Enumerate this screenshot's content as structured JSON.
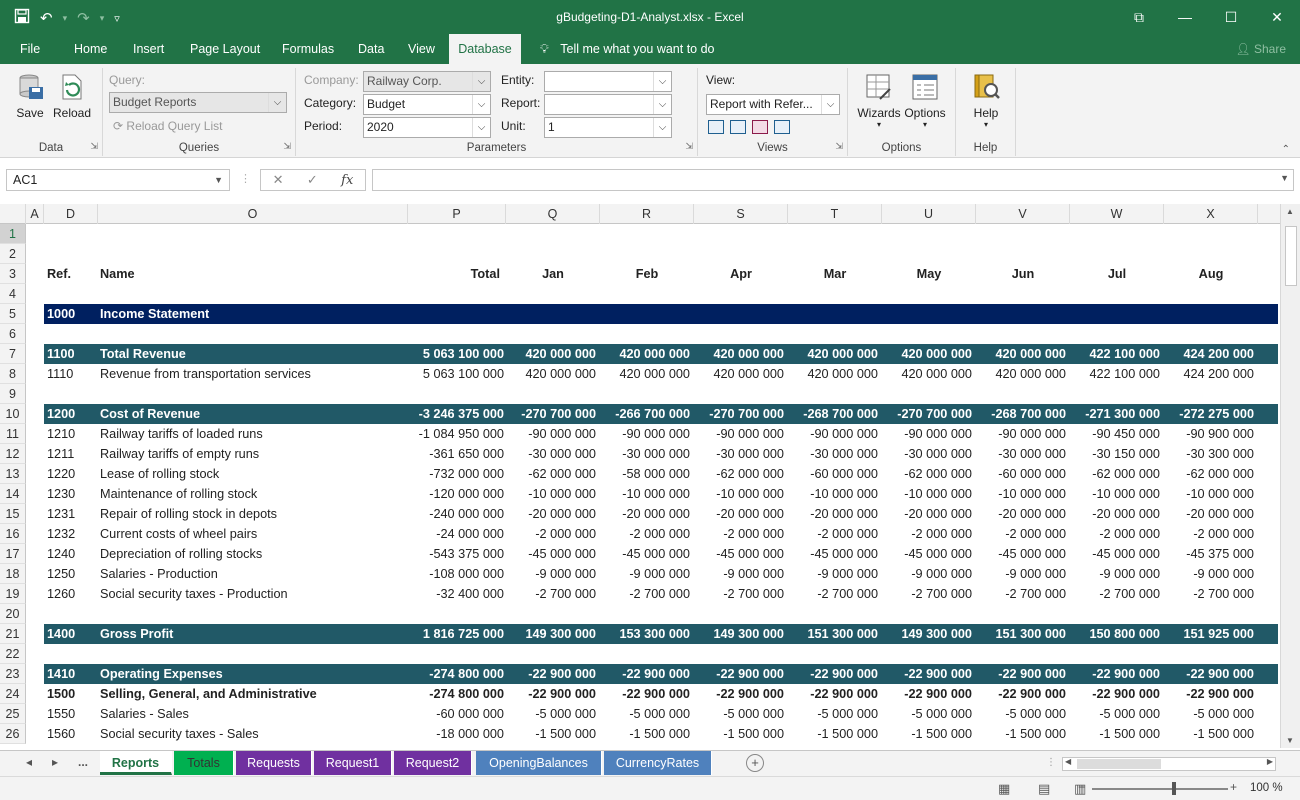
{
  "window": {
    "title": "gBudgeting-D1-Analyst.xlsx  -  Excel"
  },
  "ribbon_tabs": [
    "File",
    "Home",
    "Insert",
    "Page Layout",
    "Formulas",
    "Data",
    "View",
    "Database"
  ],
  "tell_me": "Tell me what you want to do",
  "share_label": "Share",
  "data_group": {
    "label": "Data",
    "save": "Save",
    "reload": "Reload"
  },
  "queries_group": {
    "label": "Queries",
    "query_label": "Query:",
    "query_value": "Budget Reports",
    "reload_list": "Reload Query List"
  },
  "parameters_group": {
    "label": "Parameters",
    "company_label": "Company:",
    "company_value": "Railway Corp.",
    "category_label": "Category:",
    "category_value": "Budget",
    "period_label": "Period:",
    "period_value": "2020",
    "entity_label": "Entity:",
    "entity_value": "",
    "report_label": "Report:",
    "report_value": "",
    "unit_label": "Unit:",
    "unit_value": "1"
  },
  "views_group": {
    "label": "Views",
    "view_label": "View:",
    "view_value": "Report with Refer..."
  },
  "options_group": {
    "label": "Options",
    "wizards": "Wizards",
    "options": "Options"
  },
  "help_group": {
    "label": "Help",
    "help": "Help"
  },
  "formula_bar": {
    "name_box": "AC1",
    "fx": "fx",
    "formula": ""
  },
  "columns": [
    "A",
    "D",
    "O",
    "P",
    "Q",
    "R",
    "S",
    "T",
    "U",
    "V",
    "W",
    "X"
  ],
  "row_numbers": [
    "1",
    "2",
    "3",
    "4",
    "5",
    "6",
    "7",
    "8",
    "9",
    "10",
    "11",
    "12",
    "13",
    "14",
    "15",
    "16",
    "17",
    "18",
    "19",
    "20",
    "21",
    "22",
    "23",
    "24",
    "25",
    "26"
  ],
  "header_row": {
    "ref": "Ref.",
    "name": "Name",
    "months": [
      "Total",
      "Jan",
      "Feb",
      "Apr",
      "Mar",
      "May",
      "Jun",
      "Jul",
      "Aug"
    ]
  },
  "colors": {
    "excel_green": "#217346",
    "income_band": "#002060",
    "total_band": "#215967"
  },
  "rows": [
    {
      "row": 5,
      "style": "band-dark",
      "ref": "1000",
      "name": "Income Statement",
      "values": []
    },
    {
      "row": 7,
      "style": "band",
      "ref": "1100",
      "name": "Total Revenue",
      "values": [
        "5 063 100 000",
        "420 000 000",
        "420 000 000",
        "420 000 000",
        "420 000 000",
        "420 000 000",
        "420 000 000",
        "422 100 000",
        "424 200 000"
      ]
    },
    {
      "row": 8,
      "style": "normal",
      "ref": "1110",
      "name": "Revenue from transportation services",
      "values": [
        "5 063 100 000",
        "420 000 000",
        "420 000 000",
        "420 000 000",
        "420 000 000",
        "420 000 000",
        "420 000 000",
        "422 100 000",
        "424 200 000"
      ]
    },
    {
      "row": 10,
      "style": "band",
      "ref": "1200",
      "name": "Cost of Revenue",
      "values": [
        "-3 246 375 000",
        "-270 700 000",
        "-266 700 000",
        "-270 700 000",
        "-268 700 000",
        "-270 700 000",
        "-268 700 000",
        "-271 300 000",
        "-272 275 000"
      ]
    },
    {
      "row": 11,
      "style": "normal",
      "ref": "1210",
      "name": "Railway tariffs of loaded runs",
      "values": [
        "-1 084 950 000",
        "-90 000 000",
        "-90 000 000",
        "-90 000 000",
        "-90 000 000",
        "-90 000 000",
        "-90 000 000",
        "-90 450 000",
        "-90 900 000"
      ]
    },
    {
      "row": 12,
      "style": "normal",
      "ref": "1211",
      "name": "Railway tariffs of empty runs",
      "values": [
        "-361 650 000",
        "-30 000 000",
        "-30 000 000",
        "-30 000 000",
        "-30 000 000",
        "-30 000 000",
        "-30 000 000",
        "-30 150 000",
        "-30 300 000"
      ]
    },
    {
      "row": 13,
      "style": "normal",
      "ref": "1220",
      "name": "Lease of rolling stock",
      "values": [
        "-732 000 000",
        "-62 000 000",
        "-58 000 000",
        "-62 000 000",
        "-60 000 000",
        "-62 000 000",
        "-60 000 000",
        "-62 000 000",
        "-62 000 000"
      ]
    },
    {
      "row": 14,
      "style": "normal",
      "ref": "1230",
      "name": "Maintenance of rolling stock",
      "values": [
        "-120 000 000",
        "-10 000 000",
        "-10 000 000",
        "-10 000 000",
        "-10 000 000",
        "-10 000 000",
        "-10 000 000",
        "-10 000 000",
        "-10 000 000"
      ]
    },
    {
      "row": 15,
      "style": "normal",
      "ref": "1231",
      "name": "Repair of rolling stock in depots",
      "values": [
        "-240 000 000",
        "-20 000 000",
        "-20 000 000",
        "-20 000 000",
        "-20 000 000",
        "-20 000 000",
        "-20 000 000",
        "-20 000 000",
        "-20 000 000"
      ]
    },
    {
      "row": 16,
      "style": "normal",
      "ref": "1232",
      "name": "Current costs of wheel pairs",
      "values": [
        "-24 000 000",
        "-2 000 000",
        "-2 000 000",
        "-2 000 000",
        "-2 000 000",
        "-2 000 000",
        "-2 000 000",
        "-2 000 000",
        "-2 000 000"
      ]
    },
    {
      "row": 17,
      "style": "normal",
      "ref": "1240",
      "name": "Depreciation of rolling stocks",
      "values": [
        "-543 375 000",
        "-45 000 000",
        "-45 000 000",
        "-45 000 000",
        "-45 000 000",
        "-45 000 000",
        "-45 000 000",
        "-45 000 000",
        "-45 375 000"
      ]
    },
    {
      "row": 18,
      "style": "normal",
      "ref": "1250",
      "name": "Salaries - Production",
      "values": [
        "-108 000 000",
        "-9 000 000",
        "-9 000 000",
        "-9 000 000",
        "-9 000 000",
        "-9 000 000",
        "-9 000 000",
        "-9 000 000",
        "-9 000 000"
      ]
    },
    {
      "row": 19,
      "style": "normal",
      "ref": "1260",
      "name": "Social security taxes - Production",
      "values": [
        "-32 400 000",
        "-2 700 000",
        "-2 700 000",
        "-2 700 000",
        "-2 700 000",
        "-2 700 000",
        "-2 700 000",
        "-2 700 000",
        "-2 700 000"
      ]
    },
    {
      "row": 21,
      "style": "band",
      "ref": "1400",
      "name": "Gross Profit",
      "values": [
        "1 816 725 000",
        "149 300 000",
        "153 300 000",
        "149 300 000",
        "151 300 000",
        "149 300 000",
        "151 300 000",
        "150 800 000",
        "151 925 000"
      ]
    },
    {
      "row": 23,
      "style": "band",
      "ref": "1410",
      "name": "Operating Expenses",
      "values": [
        "-274 800 000",
        "-22 900 000",
        "-22 900 000",
        "-22 900 000",
        "-22 900 000",
        "-22 900 000",
        "-22 900 000",
        "-22 900 000",
        "-22 900 000"
      ]
    },
    {
      "row": 24,
      "style": "bold",
      "ref": "1500",
      "name": "Selling, General, and Administrative",
      "values": [
        "-274 800 000",
        "-22 900 000",
        "-22 900 000",
        "-22 900 000",
        "-22 900 000",
        "-22 900 000",
        "-22 900 000",
        "-22 900 000",
        "-22 900 000"
      ]
    },
    {
      "row": 25,
      "style": "normal",
      "ref": "1550",
      "name": "Salaries - Sales",
      "values": [
        "-60 000 000",
        "-5 000 000",
        "-5 000 000",
        "-5 000 000",
        "-5 000 000",
        "-5 000 000",
        "-5 000 000",
        "-5 000 000",
        "-5 000 000"
      ]
    },
    {
      "row": 26,
      "style": "normal",
      "ref": "1560",
      "name": "Social security taxes - Sales",
      "values": [
        "-18 000 000",
        "-1 500 000",
        "-1 500 000",
        "-1 500 000",
        "-1 500 000",
        "-1 500 000",
        "-1 500 000",
        "-1 500 000",
        "-1 500 000"
      ]
    }
  ],
  "sheet_tabs": [
    {
      "label": "Reports",
      "color": "#ffffff",
      "active": true
    },
    {
      "label": "Totals",
      "color": "#00b050",
      "active": false
    },
    {
      "label": "Requests",
      "color": "#7030a0",
      "active": false
    },
    {
      "label": "Request1",
      "color": "#7030a0",
      "active": false
    },
    {
      "label": "Request2",
      "color": "#7030a0",
      "active": false
    },
    {
      "label": "OpeningBalances",
      "color": "#4f81bd",
      "active": false
    },
    {
      "label": "CurrencyRates",
      "color": "#4f81bd",
      "active": false
    }
  ],
  "sheet_nav_more": "...",
  "zoom": "100 %"
}
